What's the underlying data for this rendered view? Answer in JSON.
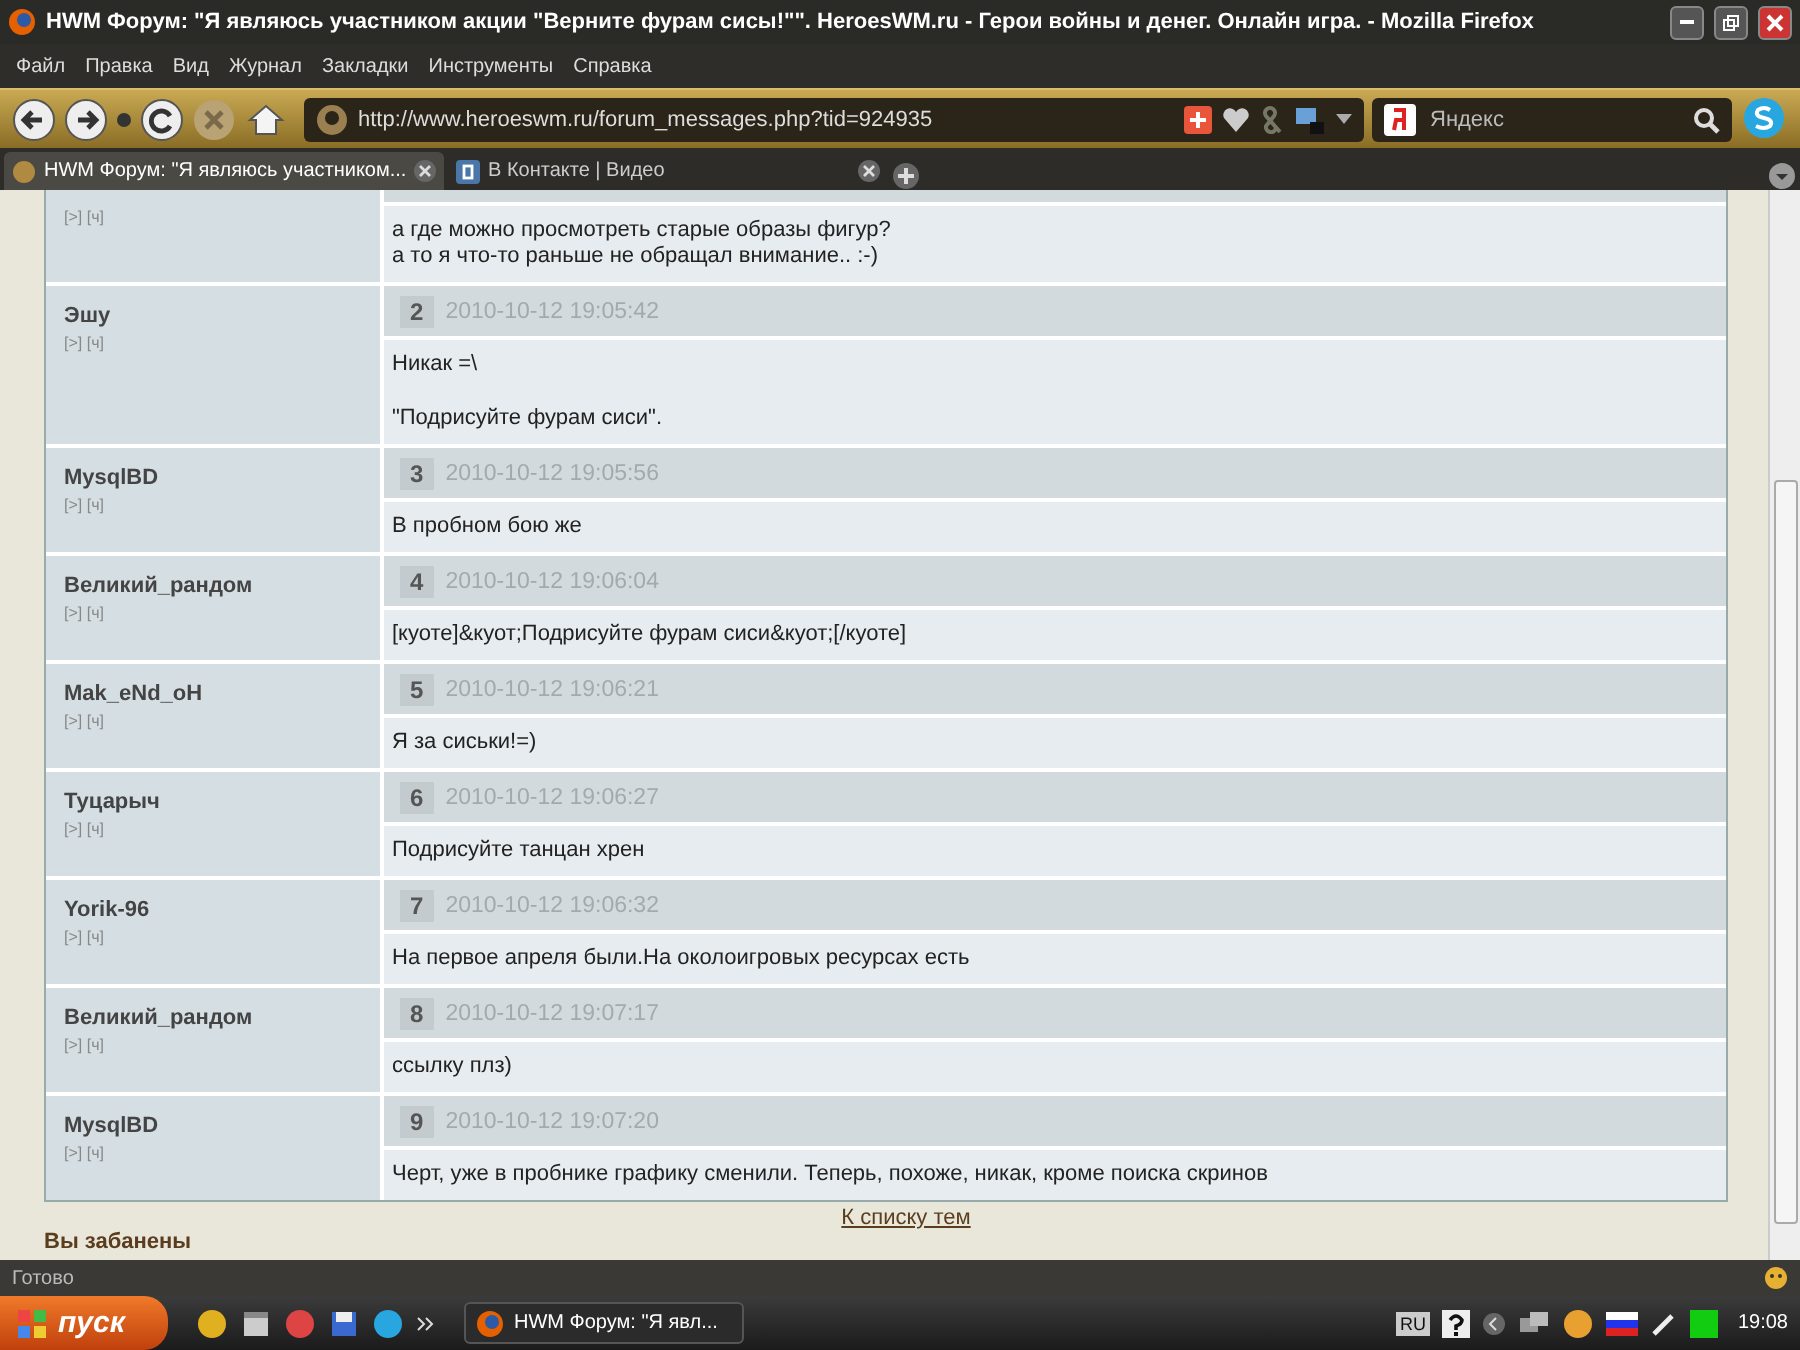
{
  "window": {
    "title": "HWM Форум: \"Я являюсь участником акции \"Верните фурам сисы!\"\". HeroesWM.ru - Герои войны и денег. Онлайн игра. - Mozilla Firefox"
  },
  "menu": [
    "Файл",
    "Правка",
    "Вид",
    "Журнал",
    "Закладки",
    "Инструменты",
    "Справка"
  ],
  "address_bar": {
    "value": "http://www.heroeswm.ru/forum_messages.php?tid=924935"
  },
  "search": {
    "placeholder": "Яндекс"
  },
  "tabs": [
    {
      "label": "HWM Форум: \"Я являюсь участником...",
      "selected": true
    },
    {
      "label": "В Контакте | Видео",
      "selected": false
    }
  ],
  "posts": [
    {
      "links": "[>] [ч]",
      "paragraphs": [
        "а где можно просмотреть старые образы фигур?\nа то я что-то раньше не обращал внимание.. :-)"
      ]
    },
    {
      "author": "Эшу",
      "links": "[>] [ч]",
      "number": "2",
      "date": "2010-10-12 19:05:42",
      "paragraphs": [
        "Никак =\\",
        "\"Подрисуйте фурам сиси\"."
      ]
    },
    {
      "author": "MysqlBD",
      "links": "[>] [ч]",
      "number": "3",
      "date": "2010-10-12 19:05:56",
      "paragraphs": [
        "В пробном бою же"
      ]
    },
    {
      "author": "Великий_рандом",
      "links": "[>] [ч]",
      "number": "4",
      "date": "2010-10-12 19:06:04",
      "paragraphs": [
        "[куоте]&куот;Подрисуйте фурам сиси&куот;[/куоте]"
      ]
    },
    {
      "author": "Mak_eNd_oH",
      "links": "[>] [ч]",
      "number": "5",
      "date": "2010-10-12 19:06:21",
      "paragraphs": [
        "Я за сиськи!=)"
      ]
    },
    {
      "author": "Туцарыч",
      "links": "[>] [ч]",
      "number": "6",
      "date": "2010-10-12 19:06:27",
      "paragraphs": [
        "Подрисуйте танцан хрен"
      ]
    },
    {
      "author": "Yorik-96",
      "links": "[>] [ч]",
      "number": "7",
      "date": "2010-10-12 19:06:32",
      "paragraphs": [
        "На первое апреля были.На околоигровых ресурсах есть"
      ]
    },
    {
      "author": "Великий_рандом",
      "links": "[>] [ч]",
      "number": "8",
      "date": "2010-10-12 19:07:17",
      "paragraphs": [
        "ссылку плз)"
      ]
    },
    {
      "author": "MysqlBD",
      "links": "[>] [ч]",
      "number": "9",
      "date": "2010-10-12 19:07:20",
      "paragraphs": [
        "Черт, уже в пробнике графику сменили. Теперь, похоже, никак, кроме поиска скринов"
      ]
    }
  ],
  "topic_list_link": "К списку тем",
  "ban_notice": "Вы забанены",
  "status_bar": "Готово",
  "taskbar": {
    "start": "пуск",
    "task": "HWM Форум: \"Я явл...",
    "language": "RU",
    "clock": "19:08"
  }
}
